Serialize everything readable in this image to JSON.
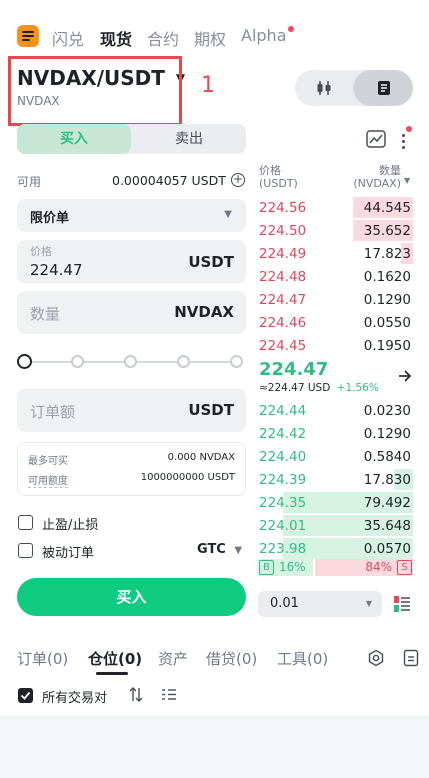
{
  "nav": {
    "tabs": [
      {
        "label": "闪兑",
        "active": false
      },
      {
        "label": "现货",
        "active": true
      },
      {
        "label": "合约",
        "active": false
      },
      {
        "label": "期权",
        "active": false
      },
      {
        "label": "Alpha",
        "active": false,
        "dot": true
      }
    ]
  },
  "pair": {
    "title": "NVDAX/USDT",
    "subtitle": "NVDAX",
    "annotation": "1"
  },
  "trade_tabs": {
    "buy": "买入",
    "sell": "卖出"
  },
  "form": {
    "available_label": "可用",
    "available_value": "0.00004057 USDT",
    "order_type": "限价单",
    "price_label": "价格",
    "price_value": "224.47",
    "price_unit": "USDT",
    "amount_placeholder": "数量",
    "amount_unit": "NVDAX",
    "slider_percent": 0,
    "total_placeholder": "订单额",
    "total_unit": "USDT",
    "max_buy_label": "最多可买",
    "max_buy_value": "0.000 NVDAX",
    "credit_label": "可用额度",
    "credit_value": "1000000000 USDT",
    "tpsl_label": "止盈/止损",
    "post_only_label": "被动订单",
    "tif_value": "GTC",
    "submit_label": "买入"
  },
  "orderbook": {
    "price_header": "价格",
    "price_unit": "(USDT)",
    "qty_header": "数量",
    "qty_unit": "(NVDAX)",
    "asks": [
      {
        "price": "224.56",
        "qty": "44.545",
        "depth": 0.39
      },
      {
        "price": "224.50",
        "qty": "35.652",
        "depth": 0.39
      },
      {
        "price": "224.49",
        "qty": "17.823",
        "depth": 0.08
      },
      {
        "price": "224.48",
        "qty": "0.1620",
        "depth": 0
      },
      {
        "price": "224.47",
        "qty": "0.1290",
        "depth": 0
      },
      {
        "price": "224.46",
        "qty": "0.0550",
        "depth": 0
      },
      {
        "price": "224.45",
        "qty": "0.1950",
        "depth": 0
      }
    ],
    "last_price": "224.47",
    "last_usd": "≈224.47 USD",
    "last_change": "+1.56%",
    "bids": [
      {
        "price": "224.44",
        "qty": "0.0230",
        "depth": 0
      },
      {
        "price": "224.42",
        "qty": "0.1290",
        "depth": 0
      },
      {
        "price": "224.40",
        "qty": "0.5840",
        "depth": 0
      },
      {
        "price": "224.39",
        "qty": "17.830",
        "depth": 0.12
      },
      {
        "price": "224.35",
        "qty": "79.492",
        "depth": 0.84
      },
      {
        "price": "224.01",
        "qty": "35.648",
        "depth": 0.84
      },
      {
        "price": "223.98",
        "qty": "0.0570",
        "depth": 0.84
      }
    ],
    "ratio_buy_tag": "B",
    "ratio_buy": "16%",
    "ratio_sell": "84%",
    "ratio_sell_tag": "S",
    "precision": "0.01"
  },
  "bottom_tabs": [
    {
      "label": "订单(0)",
      "active": false
    },
    {
      "label": "仓位(0)",
      "active": true
    },
    {
      "label": "资产",
      "active": false
    },
    {
      "label": "借贷(0)",
      "active": false
    },
    {
      "label": "工具(0)",
      "active": false
    }
  ],
  "filter": {
    "all_pairs_label": "所有交易对"
  },
  "colors": {
    "accent": "#f7931a",
    "buy": "#0ecb81",
    "sell": "#e0475c",
    "annotation": "#e5484d"
  }
}
